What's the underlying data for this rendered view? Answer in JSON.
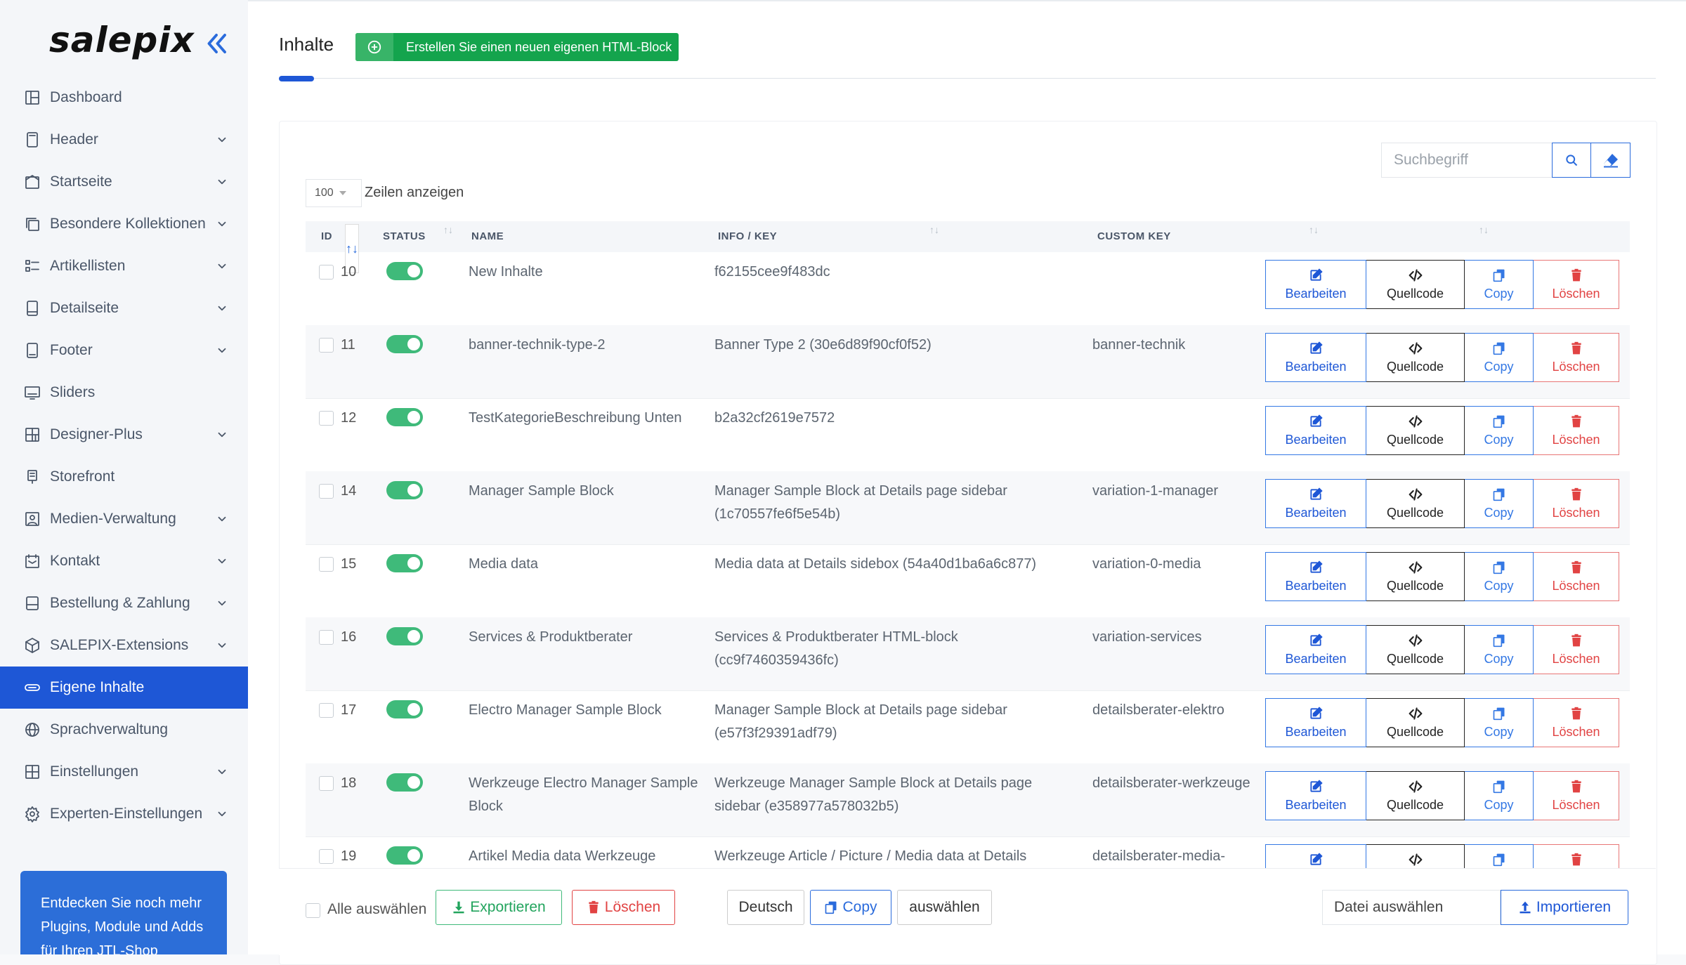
{
  "sidebar": {
    "logo": "salepix",
    "items": [
      {
        "label": "Dashboard",
        "icon": "dashboard-icon",
        "chevron": false,
        "active": false
      },
      {
        "label": "Header",
        "icon": "header-icon",
        "chevron": true,
        "active": false
      },
      {
        "label": "Startseite",
        "icon": "home-icon",
        "chevron": true,
        "active": false
      },
      {
        "label": "Besondere Kollektionen",
        "icon": "collections-icon",
        "chevron": true,
        "active": false
      },
      {
        "label": "Artikellisten",
        "icon": "list-icon",
        "chevron": true,
        "active": false
      },
      {
        "label": "Detailseite",
        "icon": "detail-icon",
        "chevron": true,
        "active": false
      },
      {
        "label": "Footer",
        "icon": "footer-icon",
        "chevron": true,
        "active": false
      },
      {
        "label": "Sliders",
        "icon": "slider-icon",
        "chevron": false,
        "active": false
      },
      {
        "label": "Designer-Plus",
        "icon": "designer-icon",
        "chevron": true,
        "active": false
      },
      {
        "label": "Storefront",
        "icon": "storefront-icon",
        "chevron": false,
        "active": false
      },
      {
        "label": "Medien-Verwaltung",
        "icon": "media-icon",
        "chevron": true,
        "active": false
      },
      {
        "label": "Kontakt",
        "icon": "contact-icon",
        "chevron": true,
        "active": false
      },
      {
        "label": "Bestellung & Zahlung",
        "icon": "order-icon",
        "chevron": true,
        "active": false
      },
      {
        "label": "SALEPIX-Extensions",
        "icon": "extensions-icon",
        "chevron": true,
        "active": false
      },
      {
        "label": "Eigene Inhalte",
        "icon": "content-icon",
        "chevron": false,
        "active": true
      },
      {
        "label": "Sprachverwaltung",
        "icon": "globe-icon",
        "chevron": false,
        "active": false
      },
      {
        "label": "Einstellungen",
        "icon": "settings-icon",
        "chevron": true,
        "active": false
      },
      {
        "label": "Experten-Einstellungen",
        "icon": "gear-icon",
        "chevron": true,
        "active": false
      }
    ],
    "promo": "Entdecken Sie noch mehr Plugins, Module und Adds für Ihren JTL-Shop"
  },
  "header": {
    "title": "Inhalte",
    "new_button": "Erstellen Sie einen neuen eigenen HTML-Block"
  },
  "toolbar": {
    "search_placeholder": "Suchbegriff",
    "rows_value": "100",
    "rows_label": "Zeilen anzeigen"
  },
  "table": {
    "columns": {
      "id": "ID",
      "status": "STATUS",
      "name": "NAME",
      "info": "INFO / KEY",
      "custom": "CUSTOM KEY"
    },
    "actions": {
      "edit": "Bearbeiten",
      "source": "Quellcode",
      "copy": "Copy",
      "delete": "Löschen"
    },
    "rows": [
      {
        "id": "10",
        "status": true,
        "name": "New Inhalte",
        "info": "f62155cee9f483dc",
        "custom_key": ""
      },
      {
        "id": "11",
        "status": true,
        "name": "banner-technik-type-2",
        "info": "Banner Type 2 (30e6d89f90cf0f52)",
        "custom_key": "banner-technik"
      },
      {
        "id": "12",
        "status": true,
        "name": "TestKategorieBeschreibung Unten",
        "info": "b2a32cf2619e7572",
        "custom_key": ""
      },
      {
        "id": "14",
        "status": true,
        "name": "Manager Sample Block",
        "info": "Manager Sample Block at Details page sidebar (1c70557fe6f5e54b)",
        "custom_key": "variation-1-manager"
      },
      {
        "id": "15",
        "status": true,
        "name": "Media data",
        "info": "Media data at Details sidebox (54a40d1ba6a6c877)",
        "custom_key": "variation-0-media"
      },
      {
        "id": "16",
        "status": true,
        "name": "Services & Produktberater",
        "info": "Services & Produktberater HTML-block (cc9f7460359436fc)",
        "custom_key": "variation-services"
      },
      {
        "id": "17",
        "status": true,
        "name": "Electro Manager Sample Block",
        "info": "Manager Sample Block at Details page sidebar (e57f3f29391adf79)",
        "custom_key": "detailsberater-elektro"
      },
      {
        "id": "18",
        "status": true,
        "name": "Werkzeuge Electro Manager Sample Block",
        "info": "Werkzeuge Manager Sample Block at Details page sidebar (e358977a578032b5)",
        "custom_key": "detailsberater-werkzeuge"
      },
      {
        "id": "19",
        "status": true,
        "name": "Artikel Media data Werkzeuge",
        "info": "Werkzeuge Article / Picture / Media data at Details",
        "custom_key": "detailsberater-media-"
      }
    ]
  },
  "bottom": {
    "select_all": "Alle auswählen",
    "export": "Exportieren",
    "delete": "Löschen",
    "language": "Deutsch",
    "copy": "Copy",
    "choose": "auswählen",
    "file_placeholder": "Datei auswählen",
    "import": "Importieren"
  },
  "colors": {
    "accent": "#1e57d6",
    "success": "#14a44d",
    "danger": "#e14343",
    "toggle_on": "#3fba7a"
  }
}
